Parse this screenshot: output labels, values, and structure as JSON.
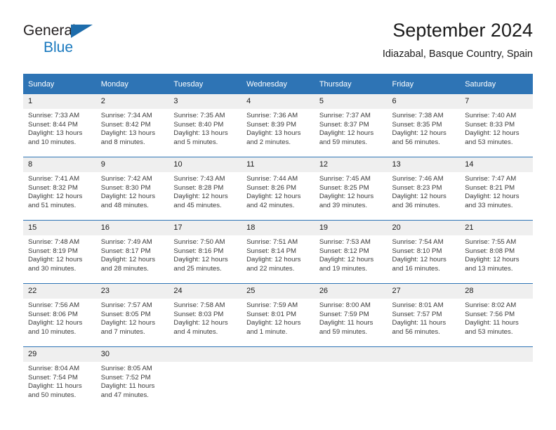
{
  "brand": {
    "line1": "General",
    "line2": "Blue",
    "logo_icon": "triangle-logo-icon"
  },
  "header": {
    "title": "September 2024",
    "subtitle": "Idiazabal, Basque Country, Spain"
  },
  "theme": {
    "header_blue": "#2e74b5",
    "daynum_gray": "#efefef",
    "brand_blue": "#1878be",
    "text": "#1a1a1a"
  },
  "calendar": {
    "weekday_headers": [
      "Sunday",
      "Monday",
      "Tuesday",
      "Wednesday",
      "Thursday",
      "Friday",
      "Saturday"
    ],
    "weeks": [
      [
        {
          "day": "1",
          "sunrise": "Sunrise: 7:33 AM",
          "sunset": "Sunset: 8:44 PM",
          "daylight": "Daylight: 13 hours and 10 minutes."
        },
        {
          "day": "2",
          "sunrise": "Sunrise: 7:34 AM",
          "sunset": "Sunset: 8:42 PM",
          "daylight": "Daylight: 13 hours and 8 minutes."
        },
        {
          "day": "3",
          "sunrise": "Sunrise: 7:35 AM",
          "sunset": "Sunset: 8:40 PM",
          "daylight": "Daylight: 13 hours and 5 minutes."
        },
        {
          "day": "4",
          "sunrise": "Sunrise: 7:36 AM",
          "sunset": "Sunset: 8:39 PM",
          "daylight": "Daylight: 13 hours and 2 minutes."
        },
        {
          "day": "5",
          "sunrise": "Sunrise: 7:37 AM",
          "sunset": "Sunset: 8:37 PM",
          "daylight": "Daylight: 12 hours and 59 minutes."
        },
        {
          "day": "6",
          "sunrise": "Sunrise: 7:38 AM",
          "sunset": "Sunset: 8:35 PM",
          "daylight": "Daylight: 12 hours and 56 minutes."
        },
        {
          "day": "7",
          "sunrise": "Sunrise: 7:40 AM",
          "sunset": "Sunset: 8:33 PM",
          "daylight": "Daylight: 12 hours and 53 minutes."
        }
      ],
      [
        {
          "day": "8",
          "sunrise": "Sunrise: 7:41 AM",
          "sunset": "Sunset: 8:32 PM",
          "daylight": "Daylight: 12 hours and 51 minutes."
        },
        {
          "day": "9",
          "sunrise": "Sunrise: 7:42 AM",
          "sunset": "Sunset: 8:30 PM",
          "daylight": "Daylight: 12 hours and 48 minutes."
        },
        {
          "day": "10",
          "sunrise": "Sunrise: 7:43 AM",
          "sunset": "Sunset: 8:28 PM",
          "daylight": "Daylight: 12 hours and 45 minutes."
        },
        {
          "day": "11",
          "sunrise": "Sunrise: 7:44 AM",
          "sunset": "Sunset: 8:26 PM",
          "daylight": "Daylight: 12 hours and 42 minutes."
        },
        {
          "day": "12",
          "sunrise": "Sunrise: 7:45 AM",
          "sunset": "Sunset: 8:25 PM",
          "daylight": "Daylight: 12 hours and 39 minutes."
        },
        {
          "day": "13",
          "sunrise": "Sunrise: 7:46 AM",
          "sunset": "Sunset: 8:23 PM",
          "daylight": "Daylight: 12 hours and 36 minutes."
        },
        {
          "day": "14",
          "sunrise": "Sunrise: 7:47 AM",
          "sunset": "Sunset: 8:21 PM",
          "daylight": "Daylight: 12 hours and 33 minutes."
        }
      ],
      [
        {
          "day": "15",
          "sunrise": "Sunrise: 7:48 AM",
          "sunset": "Sunset: 8:19 PM",
          "daylight": "Daylight: 12 hours and 30 minutes."
        },
        {
          "day": "16",
          "sunrise": "Sunrise: 7:49 AM",
          "sunset": "Sunset: 8:17 PM",
          "daylight": "Daylight: 12 hours and 28 minutes."
        },
        {
          "day": "17",
          "sunrise": "Sunrise: 7:50 AM",
          "sunset": "Sunset: 8:16 PM",
          "daylight": "Daylight: 12 hours and 25 minutes."
        },
        {
          "day": "18",
          "sunrise": "Sunrise: 7:51 AM",
          "sunset": "Sunset: 8:14 PM",
          "daylight": "Daylight: 12 hours and 22 minutes."
        },
        {
          "day": "19",
          "sunrise": "Sunrise: 7:53 AM",
          "sunset": "Sunset: 8:12 PM",
          "daylight": "Daylight: 12 hours and 19 minutes."
        },
        {
          "day": "20",
          "sunrise": "Sunrise: 7:54 AM",
          "sunset": "Sunset: 8:10 PM",
          "daylight": "Daylight: 12 hours and 16 minutes."
        },
        {
          "day": "21",
          "sunrise": "Sunrise: 7:55 AM",
          "sunset": "Sunset: 8:08 PM",
          "daylight": "Daylight: 12 hours and 13 minutes."
        }
      ],
      [
        {
          "day": "22",
          "sunrise": "Sunrise: 7:56 AM",
          "sunset": "Sunset: 8:06 PM",
          "daylight": "Daylight: 12 hours and 10 minutes."
        },
        {
          "day": "23",
          "sunrise": "Sunrise: 7:57 AM",
          "sunset": "Sunset: 8:05 PM",
          "daylight": "Daylight: 12 hours and 7 minutes."
        },
        {
          "day": "24",
          "sunrise": "Sunrise: 7:58 AM",
          "sunset": "Sunset: 8:03 PM",
          "daylight": "Daylight: 12 hours and 4 minutes."
        },
        {
          "day": "25",
          "sunrise": "Sunrise: 7:59 AM",
          "sunset": "Sunset: 8:01 PM",
          "daylight": "Daylight: 12 hours and 1 minute."
        },
        {
          "day": "26",
          "sunrise": "Sunrise: 8:00 AM",
          "sunset": "Sunset: 7:59 PM",
          "daylight": "Daylight: 11 hours and 59 minutes."
        },
        {
          "day": "27",
          "sunrise": "Sunrise: 8:01 AM",
          "sunset": "Sunset: 7:57 PM",
          "daylight": "Daylight: 11 hours and 56 minutes."
        },
        {
          "day": "28",
          "sunrise": "Sunrise: 8:02 AM",
          "sunset": "Sunset: 7:56 PM",
          "daylight": "Daylight: 11 hours and 53 minutes."
        }
      ],
      [
        {
          "day": "29",
          "sunrise": "Sunrise: 8:04 AM",
          "sunset": "Sunset: 7:54 PM",
          "daylight": "Daylight: 11 hours and 50 minutes."
        },
        {
          "day": "30",
          "sunrise": "Sunrise: 8:05 AM",
          "sunset": "Sunset: 7:52 PM",
          "daylight": "Daylight: 11 hours and 47 minutes."
        },
        {
          "day": "",
          "sunrise": "",
          "sunset": "",
          "daylight": ""
        },
        {
          "day": "",
          "sunrise": "",
          "sunset": "",
          "daylight": ""
        },
        {
          "day": "",
          "sunrise": "",
          "sunset": "",
          "daylight": ""
        },
        {
          "day": "",
          "sunrise": "",
          "sunset": "",
          "daylight": ""
        },
        {
          "day": "",
          "sunrise": "",
          "sunset": "",
          "daylight": ""
        }
      ]
    ]
  }
}
